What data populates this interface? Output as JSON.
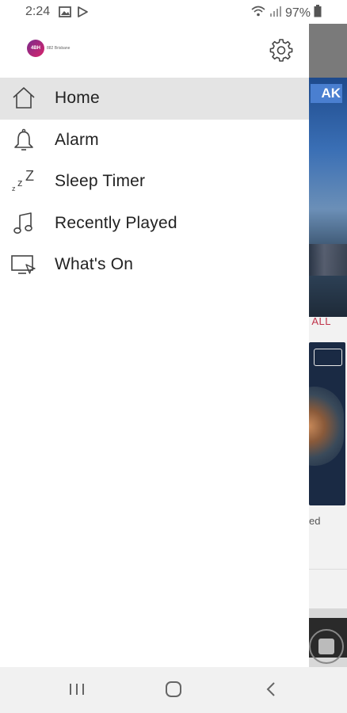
{
  "status_bar": {
    "time": "2:24",
    "battery": "97%",
    "icons": [
      "image-icon",
      "play-icon",
      "wifi-icon",
      "signal-icon",
      "battery-icon"
    ]
  },
  "drawer": {
    "logo_text": "4BH",
    "logo_subtext": "882 Brisbane",
    "menu": [
      {
        "label": "Home",
        "icon": "home-icon",
        "active": true
      },
      {
        "label": "Alarm",
        "icon": "bell-icon",
        "active": false
      },
      {
        "label": "Sleep Timer",
        "icon": "sleep-zzz-icon",
        "active": false
      },
      {
        "label": "Recently Played",
        "icon": "music-note-icon",
        "active": false
      },
      {
        "label": "What's On",
        "icon": "tv-cast-icon",
        "active": false
      }
    ]
  },
  "background_app": {
    "hero_badge": "AK",
    "see_all": "ALL",
    "card_caption": "ed"
  },
  "nav_bar": {
    "buttons": [
      "recent-apps",
      "home",
      "back"
    ]
  },
  "colors": {
    "active_item_bg": "#e4e4e4",
    "text": "#222222",
    "accent": "#c0334a"
  }
}
